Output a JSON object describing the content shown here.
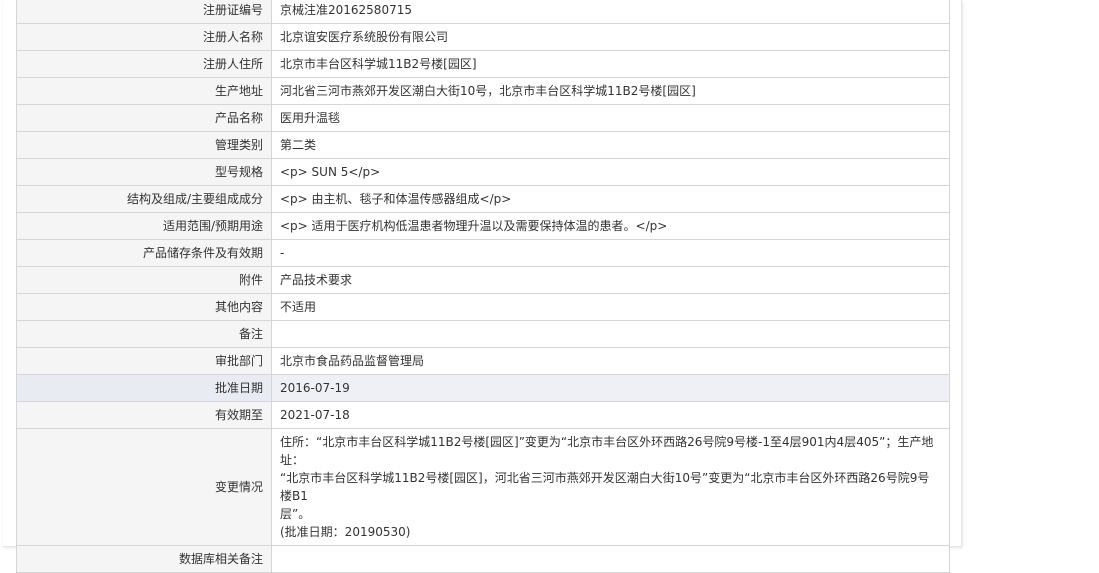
{
  "rows": [
    {
      "label": "注册证编号",
      "value": "京械注准20162580715"
    },
    {
      "label": "注册人名称",
      "value": "北京谊安医疗系统股份有限公司"
    },
    {
      "label": "注册人住所",
      "value": "北京市丰台区科学城11B2号楼[园区]"
    },
    {
      "label": "生产地址",
      "value": "河北省三河市燕郊开发区潮白大街10号，北京市丰台区科学城11B2号楼[园区]"
    },
    {
      "label": "产品名称",
      "value": "医用升温毯"
    },
    {
      "label": "管理类别",
      "value": "第二类"
    },
    {
      "label": "型号规格",
      "value": "<p> SUN 5</p>"
    },
    {
      "label": "结构及组成/主要组成成分",
      "value": "<p> 由主机、毯子和体温传感器组成</p>"
    },
    {
      "label": "适用范围/预期用途",
      "value": "<p> 适用于医疗机构低温患者物理升温以及需要保持体温的患者。</p>"
    },
    {
      "label": "产品储存条件及有效期",
      "value": "-"
    },
    {
      "label": "附件",
      "value": "产品技术要求"
    },
    {
      "label": "其他内容",
      "value": "不适用"
    },
    {
      "label": "备注",
      "value": ""
    },
    {
      "label": "审批部门",
      "value": "北京市食品药品监督管理局"
    },
    {
      "label": "批准日期",
      "value": "2016-07-19"
    },
    {
      "label": "有效期至",
      "value": "2021-07-18"
    },
    {
      "label": "变更情况",
      "lines": [
        "住所：“北京市丰台区科学城11B2号楼[园区]”变更为“北京市丰台区外环西路26号院9号楼-1至4层901内4层405”；生产地址：",
        "“北京市丰台区科学城11B2号楼[园区]，河北省三河市燕郊开发区潮白大街10号”变更为“北京市丰台区外环西路26号院9号楼B1",
        "层”。",
        "(批准日期：20190530)"
      ]
    },
    {
      "label": "数据库相关备注",
      "value": ""
    }
  ]
}
